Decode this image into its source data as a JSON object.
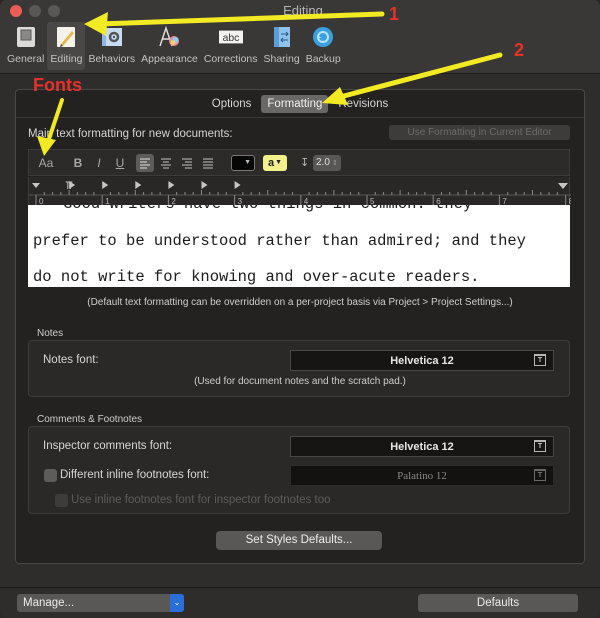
{
  "window": {
    "title": "Editing"
  },
  "toolbar": {
    "items": [
      {
        "label": "General",
        "icon": "general-icon",
        "active": false
      },
      {
        "label": "Editing",
        "icon": "editing-pencil-icon",
        "active": true
      },
      {
        "label": "Behaviors",
        "icon": "behaviors-gear-icon",
        "active": false
      },
      {
        "label": "Appearance",
        "icon": "appearance-color-icon",
        "active": false
      },
      {
        "label": "Corrections",
        "icon": "corrections-abc-icon",
        "active": false
      },
      {
        "label": "Sharing",
        "icon": "sharing-icon",
        "active": false
      },
      {
        "label": "Backup",
        "icon": "backup-icon",
        "active": false
      }
    ]
  },
  "tabs": [
    {
      "label": "Options",
      "selected": false
    },
    {
      "label": "Formatting",
      "selected": true
    },
    {
      "label": "Revisions",
      "selected": false
    }
  ],
  "formatting": {
    "main_label": "Main text formatting for new documents:",
    "use_current_button": "Use Formatting in Current Editor",
    "fonts_button": "Aa",
    "bold": "B",
    "italic": "I",
    "underline": "U",
    "alignment_selected": "left",
    "text_color": "#060606",
    "highlight_label": "a",
    "highlight_color": "#f4f08a",
    "line_spacing": "2.0",
    "ruler_numbers": [
      "0",
      "1",
      "2",
      "3",
      "4",
      "5",
      "6",
      "7",
      "8"
    ],
    "sample_text": [
      "Good writers have two things in common: they",
      "prefer to be understood rather than admired; and they",
      "do not write for knowing and over-acute readers."
    ],
    "override_note": "(Default text formatting can be overridden on a per-project basis via Project > Project Settings...)"
  },
  "notes": {
    "group_title": "Notes",
    "font_label": "Notes font:",
    "font_value": "Helvetica 12",
    "hint": "(Used for document notes and the scratch pad.)"
  },
  "comments": {
    "group_title": "Comments & Footnotes",
    "inspector_label": "Inspector comments font:",
    "inspector_value": "Helvetica 12",
    "inline_checkbox_label": "Different inline footnotes font:",
    "inline_checked": false,
    "inline_value": "Palatino 12",
    "use_inline_label": "Use inline footnotes font for inspector footnotes too",
    "use_inline_checked": false
  },
  "buttons": {
    "set_styles": "Set Styles Defaults...",
    "manage": "Manage...",
    "defaults": "Defaults"
  },
  "annotations": {
    "marker_1": "1",
    "marker_2": "2",
    "fonts_label": "Fonts",
    "arrow_color": "#f2ea22",
    "text_color": "#e8302a"
  }
}
